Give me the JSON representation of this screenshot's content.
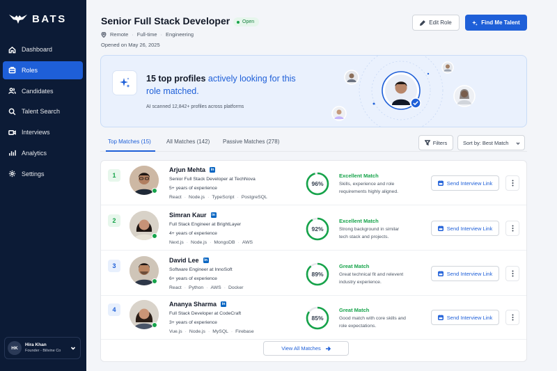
{
  "brand": {
    "name": "BATS"
  },
  "sidebar": {
    "items": [
      {
        "label": "Dashboard",
        "icon": "home-icon"
      },
      {
        "label": "Roles",
        "icon": "briefcase-icon",
        "active": true
      },
      {
        "label": "Candidates",
        "icon": "users-icon"
      },
      {
        "label": "Talent Search",
        "icon": "search-icon"
      },
      {
        "label": "Interviews",
        "icon": "video-icon"
      },
      {
        "label": "Analytics",
        "icon": "bar-chart-icon"
      },
      {
        "label": "Settings",
        "icon": "gear-icon"
      }
    ],
    "user": {
      "initials": "HK",
      "name": "Hira Khan",
      "role": "Founder - Bilivine Co"
    }
  },
  "header": {
    "title": "Senior Full Stack Developer",
    "status": "Open",
    "location": "Remote",
    "type": "Full-time",
    "department": "Engineering",
    "opened": "Opened on May 26, 2025",
    "edit_label": "Edit Role",
    "find_label": "Find Me Talent"
  },
  "banner": {
    "heading_strong": "15 top profiles",
    "heading_highlight": "actively looking for",
    "heading_tail": "this role matched.",
    "subtitle": "AI scanned 12,842+ profiles across platforms"
  },
  "tabs": [
    {
      "label": "Top Matches (15)",
      "active": true
    },
    {
      "label": "All Matches (142)"
    },
    {
      "label": "Passive Matches (278)"
    }
  ],
  "toolbar": {
    "filters_label": "Filters",
    "sort_label": "Sort by: Best Match"
  },
  "candidates": [
    {
      "rank": "1",
      "name": "Arjun Mehta",
      "role": "Senior Full Stack Developer at TechNova",
      "experience": "5+ years of experience",
      "skills": [
        "React",
        "Node.js",
        "TypeScript",
        "PostgreSQL"
      ],
      "match_percent": 96,
      "match_label_text": "96%",
      "match_label": "Excellent Match",
      "match_desc": "Skills, experience and role requirements highly aligned.",
      "action_label": "Send Interview Link",
      "rank_bg": "#e7f7ec",
      "rank_color": "#16a34a"
    },
    {
      "rank": "2",
      "name": "Simran Kaur",
      "role": "Full Stack Engineer at BrightLayer",
      "experience": "4+ years of experience",
      "skills": [
        "Next.js",
        "Node.js",
        "MongoDB",
        "AWS"
      ],
      "match_percent": 92,
      "match_label_text": "92%",
      "match_label": "Excellent Match",
      "match_desc": "Strong background in similar tech stack and projects.",
      "action_label": "Send Interview Link",
      "rank_bg": "#e7f7ec",
      "rank_color": "#16a34a"
    },
    {
      "rank": "3",
      "name": "David Lee",
      "role": "Software Engineer at InnoSoft",
      "experience": "6+ years of experience",
      "skills": [
        "React",
        "Python",
        "AWS",
        "Docker"
      ],
      "match_percent": 89,
      "match_label_text": "89%",
      "match_label": "Great Match",
      "match_desc": "Great technical fit and relevent industry experience.",
      "action_label": "Send Interview Link",
      "rank_bg": "#e8f0fd",
      "rank_color": "#1e5fd8"
    },
    {
      "rank": "4",
      "name": "Ananya Sharma",
      "role": "Full Stack Developer at CodeCraft",
      "experience": "3+ years of experience",
      "skills": [
        "Vue.js",
        "Node.js",
        "MySQL",
        "Firebase"
      ],
      "match_percent": 85,
      "match_label_text": "85%",
      "match_label": "Great Match",
      "match_desc": "Good match with core skills and role expectations.",
      "action_label": "Send Interview Link",
      "rank_bg": "#e8f0fd",
      "rank_color": "#1e5fd8"
    }
  ],
  "view_all_label": "View All Matches",
  "colors": {
    "accent": "#1e5fd8",
    "sidebar": "#0c1b36",
    "success": "#16a34a"
  }
}
